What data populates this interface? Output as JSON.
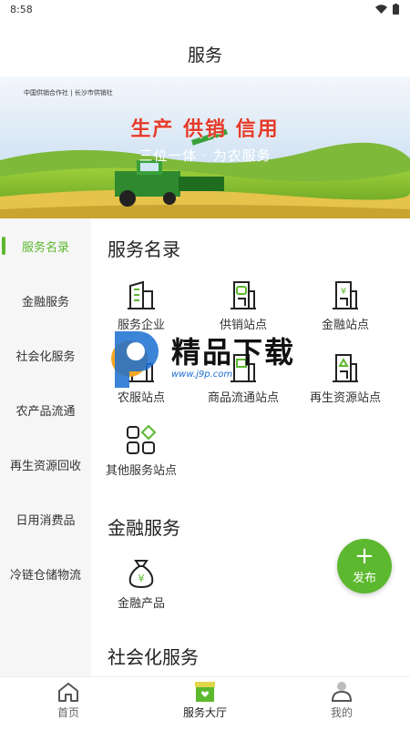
{
  "status_bar": {
    "time": "8:58"
  },
  "header": {
    "title": "服务"
  },
  "banner": {
    "logo_text": "中国供销合作社 | 长沙市供销社",
    "slogan": "生产 供销 信用",
    "subslogan": "三位一体 · 为农服务"
  },
  "sidebar": {
    "items": [
      {
        "label": "服务名录",
        "active": true
      },
      {
        "label": "金融服务"
      },
      {
        "label": "社会化服务"
      },
      {
        "label": "农产品流通"
      },
      {
        "label": "再生资源回收"
      },
      {
        "label": "日用消费品"
      },
      {
        "label": "冷链仓储物流"
      }
    ]
  },
  "sections": {
    "directory": {
      "title": "服务名录",
      "items": [
        {
          "label": "服务企业",
          "icon": "building-icon"
        },
        {
          "label": "供销站点",
          "icon": "supply-station-icon"
        },
        {
          "label": "金融站点",
          "icon": "finance-station-icon"
        },
        {
          "label": "农服站点",
          "icon": "agri-station-icon"
        },
        {
          "label": "商品流通站点",
          "icon": "goods-station-icon"
        },
        {
          "label": "再生资源站点",
          "icon": "recycle-station-icon"
        },
        {
          "label": "其他服务站点",
          "icon": "grid-icon"
        }
      ]
    },
    "finance": {
      "title": "金融服务",
      "items": [
        {
          "label": "金融产品",
          "icon": "money-bag-icon"
        }
      ]
    },
    "social": {
      "title": "社会化服务"
    }
  },
  "fab": {
    "plus": "+",
    "label": "发布"
  },
  "watermark": {
    "text": "精品下载",
    "url": "www.j9p.com"
  },
  "tabbar": {
    "items": [
      {
        "label": "首页",
        "icon": "home-icon"
      },
      {
        "label": "服务大厅",
        "icon": "service-hall-icon",
        "active": true
      },
      {
        "label": "我的",
        "icon": "user-icon"
      }
    ]
  },
  "colors": {
    "accent": "#5cb82e",
    "slogan": "#e43a2a"
  }
}
